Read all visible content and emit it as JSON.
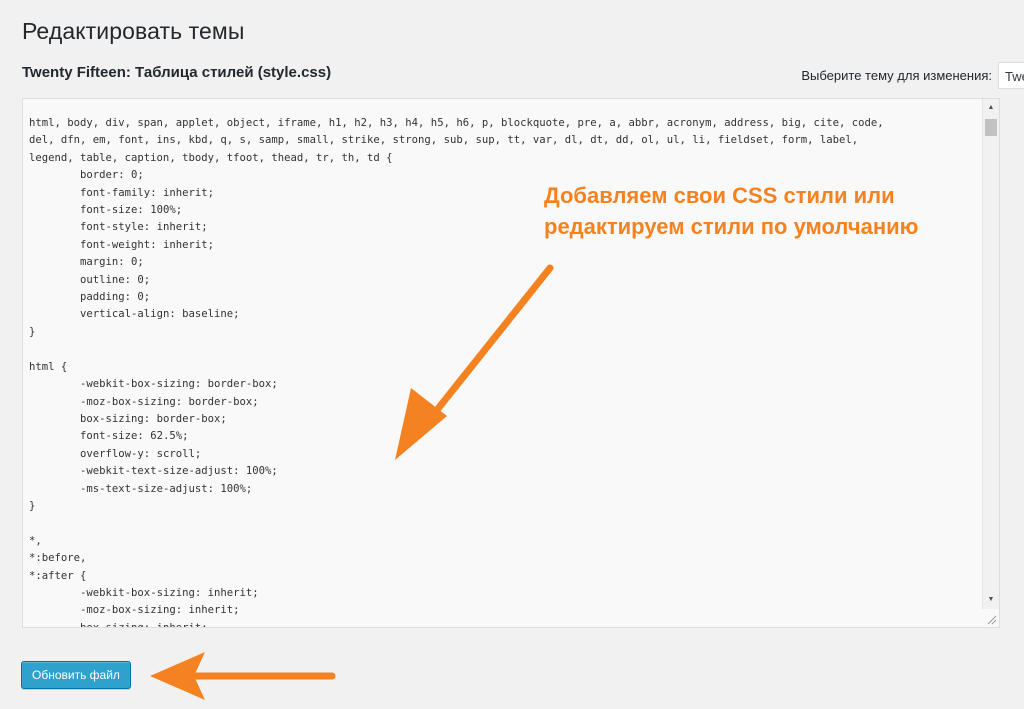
{
  "header": {
    "title": "Редактировать темы",
    "file_title": "Twenty Fifteen: Таблица стилей (style.css)"
  },
  "theme_select": {
    "label": "Выберите тему для изменения:",
    "selected": "Twenty Fifteen"
  },
  "editor": {
    "code": "html, body, div, span, applet, object, iframe, h1, h2, h3, h4, h5, h6, p, blockquote, pre, a, abbr, acronym, address, big, cite, code,\ndel, dfn, em, font, ins, kbd, q, s, samp, small, strike, strong, sub, sup, tt, var, dl, dt, dd, ol, ul, li, fieldset, form, label,\nlegend, table, caption, tbody, tfoot, thead, tr, th, td {\n\tborder: 0;\n\tfont-family: inherit;\n\tfont-size: 100%;\n\tfont-style: inherit;\n\tfont-weight: inherit;\n\tmargin: 0;\n\toutline: 0;\n\tpadding: 0;\n\tvertical-align: baseline;\n}\n\nhtml {\n\t-webkit-box-sizing: border-box;\n\t-moz-box-sizing: border-box;\n\tbox-sizing: border-box;\n\tfont-size: 62.5%;\n\toverflow-y: scroll;\n\t-webkit-text-size-adjust: 100%;\n\t-ms-text-size-adjust: 100%;\n}\n\n*,\n*:before,\n*:after {\n\t-webkit-box-sizing: inherit;\n\t-moz-box-sizing: inherit;\n\tbox-sizing: inherit;",
    "scrollbar": {
      "up_arrow_icon": "triangle-up-icon",
      "down_arrow_icon": "triangle-down-icon"
    }
  },
  "annotation": {
    "line1": "Добавляем свои CSS стили или",
    "line2": "редактируем стили по умолчанию",
    "color": "#f58220"
  },
  "actions": {
    "update_label": "Обновить файл"
  },
  "colors": {
    "background": "#f1f1f1",
    "editor_bg": "#f9f9f9",
    "button_bg": "#2ea2cc",
    "arrow": "#f58220"
  }
}
